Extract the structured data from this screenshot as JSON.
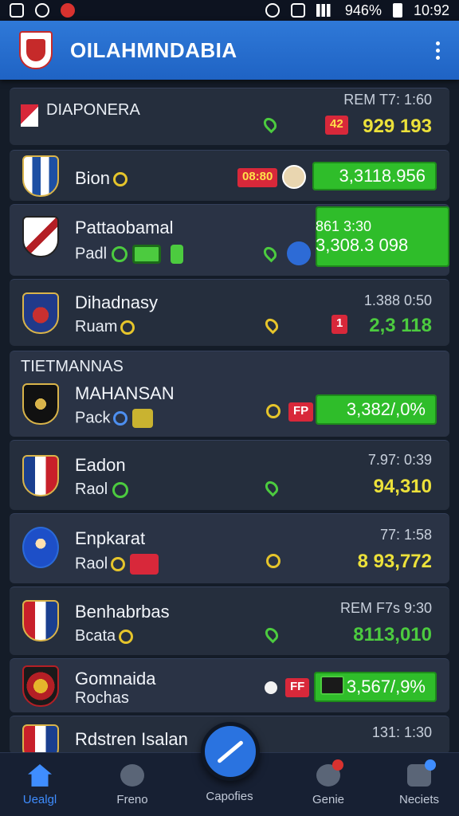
{
  "status_bar": {
    "battery": "946%",
    "time": "10:92"
  },
  "app": {
    "title": "OILAHMNDABIA"
  },
  "rows": [
    {
      "section_label": "DIAPONERA",
      "time": "REM T7: 1:60",
      "badge": "42",
      "value": "929 193"
    },
    {
      "name": "Bion",
      "badge": "08:80",
      "value": "3,3118.956"
    },
    {
      "name": "Pattaobamal",
      "sub": "Padl",
      "time": "861 3:30",
      "value": "3,308.3 098"
    },
    {
      "name": "Dihadnasy",
      "sub": "Ruam",
      "time": "1.388 0:50",
      "badge": "1",
      "value": "2,3 118"
    },
    {
      "section_label": "TIETMANNAS",
      "name": "MAHANSAN",
      "sub": "Pack",
      "badge": "FP",
      "value": "3,382/,0%"
    },
    {
      "name": "Eadon",
      "sub": "Raol",
      "time": "7.97: 0:39",
      "value": "94,310"
    },
    {
      "name": "Enpkarat",
      "sub": "Raol",
      "time": "77: 1:58",
      "value": "8 93,772"
    },
    {
      "name": "Benhabrbas",
      "sub": "Bcata",
      "time": "REM F7s 9:30",
      "value": "8113,010"
    },
    {
      "name": "Gomnaida",
      "sub": "Rochas",
      "badge": "FF",
      "value": "3,567/,9%"
    },
    {
      "name": "Rdstren Isalan",
      "time": "131: 1:30"
    }
  ],
  "bottom_nav": [
    {
      "label": "Uealgl",
      "icon": "home-icon"
    },
    {
      "label": "Freno",
      "icon": "ball-icon"
    },
    {
      "label": "Capofies",
      "icon": "pen-icon"
    },
    {
      "label": "Genie",
      "icon": "camera-icon"
    },
    {
      "label": "Neciets",
      "icon": "notifications-icon"
    }
  ],
  "colors": {
    "accent": "#2a73e0",
    "positive": "#4ccb3f",
    "highlight": "#ece13a",
    "alert": "#d8283a"
  }
}
